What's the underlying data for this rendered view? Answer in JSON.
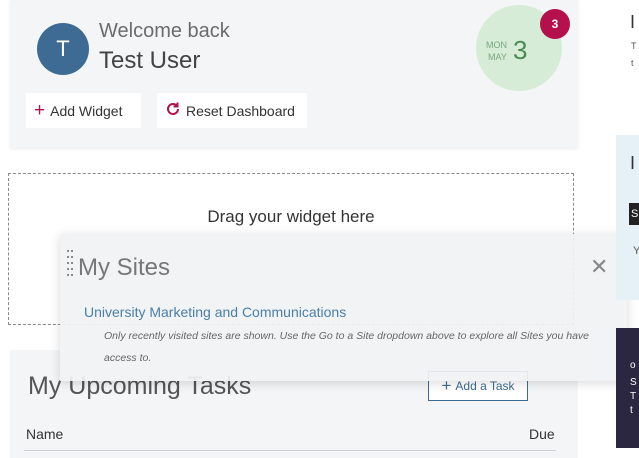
{
  "welcome": {
    "avatar_initial": "T",
    "greeting": "Welcome back",
    "user_name": "Test User",
    "date": {
      "dow": "MON",
      "month": "MAY",
      "day": "3"
    },
    "notification_count": "3",
    "add_widget_label": "Add Widget",
    "add_widget_icon": "plus-icon",
    "reset_dashboard_label": "Reset Dashboard",
    "reset_icon": "refresh-icon"
  },
  "drop_zone": {
    "text": "Drag your widget here"
  },
  "tasks": {
    "title": "My Upcoming Tasks",
    "add_task_label": "Add a Task",
    "columns": {
      "name": "Name",
      "due": "Due"
    }
  },
  "sites": {
    "title": "My Sites",
    "items": [
      "University Marketing and Communications"
    ],
    "note": "Only recently visited sites are shown. Use the Go to a Site dropdown above to explore all Sites you have access to."
  },
  "right_panel": {
    "top_letter": "I",
    "top_line1": "T",
    "top_line2": "t",
    "blue_letter": "I",
    "blue_box": "S",
    "blue_line": "Y",
    "dark_lines": [
      "o",
      "S",
      "T",
      "t"
    ]
  },
  "colors": {
    "accent_blue": "#3d6b94",
    "badge_red": "#b3104c",
    "date_green": "#d6ecd7",
    "link_blue": "#4a7fa8"
  }
}
